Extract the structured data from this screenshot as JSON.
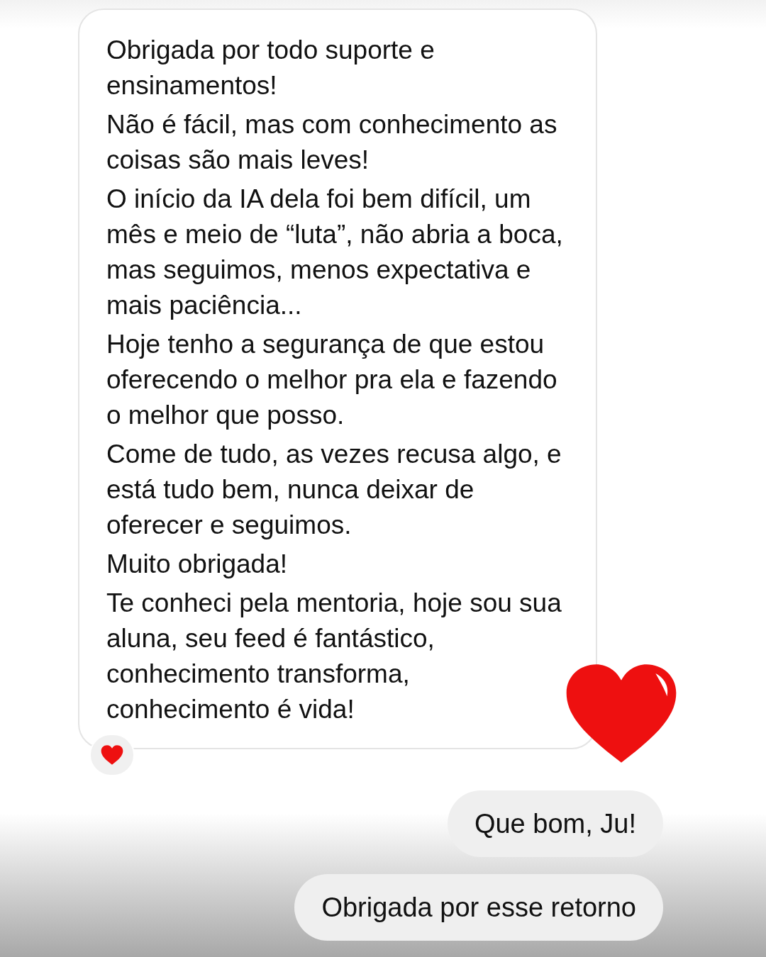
{
  "messages": [
    {
      "kind": "received",
      "paragraphs": [
        "Obrigada por todo suporte e ensinamentos!",
        "Não é fácil, mas com conhecimento as coisas são mais leves!",
        "O início da IA dela foi bem difícil, um mês e meio de “luta”, não abria a boca, mas seguimos, menos expectativa e mais paciência...",
        "Hoje tenho a segurança de que estou oferecendo o melhor pra ela e fazendo o melhor que posso.",
        "Come de tudo, as vezes recusa algo, e está tudo bem, nunca deixar de oferecer e seguimos.",
        "Muito obrigada!",
        "Te conheci pela mentoria, hoje sou sua aluna, seu feed é fantástico, conhecimento transforma, conhecimento é vida!"
      ],
      "reacted": true,
      "sticker": true
    },
    {
      "kind": "sent",
      "paragraphs": [
        "Que bom, Ju!"
      ]
    },
    {
      "kind": "sent",
      "paragraphs": [
        "Obrigada por esse retorno"
      ]
    }
  ]
}
